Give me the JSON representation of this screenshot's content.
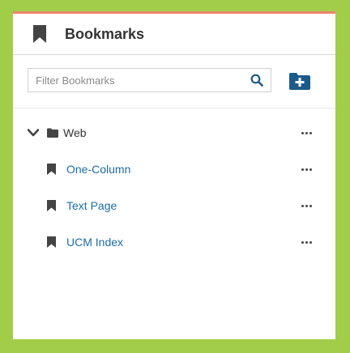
{
  "header": {
    "title": "Bookmarks",
    "icon": "bookmark-icon"
  },
  "toolbar": {
    "search_placeholder": "Filter Bookmarks",
    "search_value": "",
    "search_icon": "search-icon",
    "add_folder_icon": "folder-plus-icon",
    "accent_color": "#1c5a8a"
  },
  "tree": {
    "folder": {
      "label": "Web",
      "expanded": true,
      "icon": "folder-icon"
    },
    "items": [
      {
        "label": "One-Column",
        "icon": "bookmark-icon"
      },
      {
        "label": "Text Page",
        "icon": "bookmark-icon"
      },
      {
        "label": "UCM Index",
        "icon": "bookmark-icon"
      }
    ]
  },
  "colors": {
    "page_background": "#a2cd48",
    "top_border": "#f0846e",
    "link": "#1c6ca8"
  }
}
